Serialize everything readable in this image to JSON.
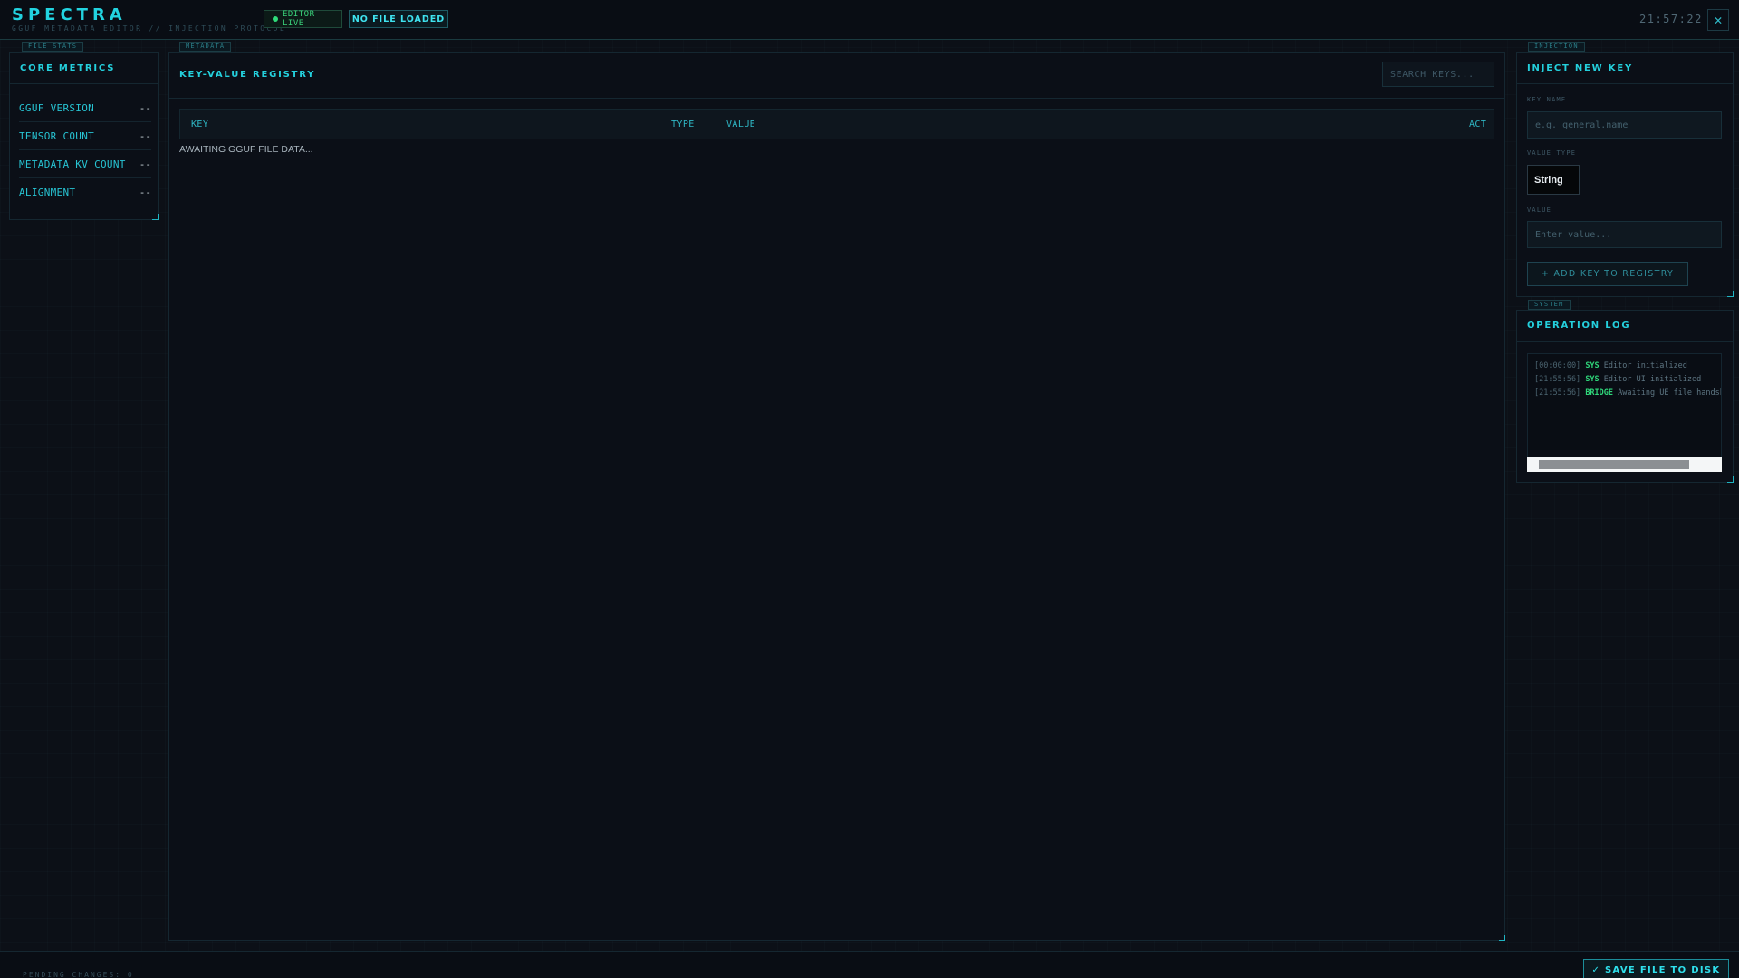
{
  "app": {
    "brand": "SPECTRA",
    "subtitle": "GGUF METADATA EDITOR // INJECTION PROTOCOL",
    "status": "EDITOR LIVE",
    "file_status": "NO FILE LOADED",
    "clock": "21:57:22",
    "close_glyph": "✕"
  },
  "file_stats": {
    "tag": "FILE STATS",
    "title": "CORE METRICS",
    "metrics": [
      {
        "label": "GGUF VERSION",
        "value": "--"
      },
      {
        "label": "TENSOR COUNT",
        "value": "--"
      },
      {
        "label": "METADATA KV COUNT",
        "value": "--"
      },
      {
        "label": "ALIGNMENT",
        "value": "--"
      }
    ]
  },
  "metadata": {
    "tag": "METADATA",
    "title": "KEY-VALUE REGISTRY",
    "search_placeholder": "SEARCH KEYS...",
    "columns": {
      "key": "KEY",
      "type": "TYPE",
      "value": "VALUE",
      "act": "ACT"
    },
    "empty_message": "AWAITING GGUF FILE DATA..."
  },
  "injection": {
    "tag": "INJECTION",
    "title": "INJECT NEW KEY",
    "key_name_label": "KEY NAME",
    "key_name_placeholder": "e.g. general.name",
    "value_type_label": "VALUE TYPE",
    "value_type_selected": "String",
    "value_label": "VALUE",
    "value_placeholder": "Enter value...",
    "add_button": "+ ADD KEY TO REGISTRY"
  },
  "system": {
    "tag": "SYSTEM",
    "title": "OPERATION LOG",
    "log": [
      {
        "time": "[00:00:00]",
        "source": "SYS",
        "message": "Editor initialized"
      },
      {
        "time": "[21:55:56]",
        "source": "SYS",
        "message": "Editor UI initialized"
      },
      {
        "time": "[21:55:56]",
        "source": "BRIDGE",
        "message": "Awaiting UE file handshake"
      }
    ]
  },
  "footer": {
    "pending": "PENDING CHANGES: 0",
    "save_button": "✓ SAVE FILE TO DISK"
  },
  "colors": {
    "accent": "#22d3e0",
    "success": "#2fdc7a",
    "background": "#0c1017"
  }
}
